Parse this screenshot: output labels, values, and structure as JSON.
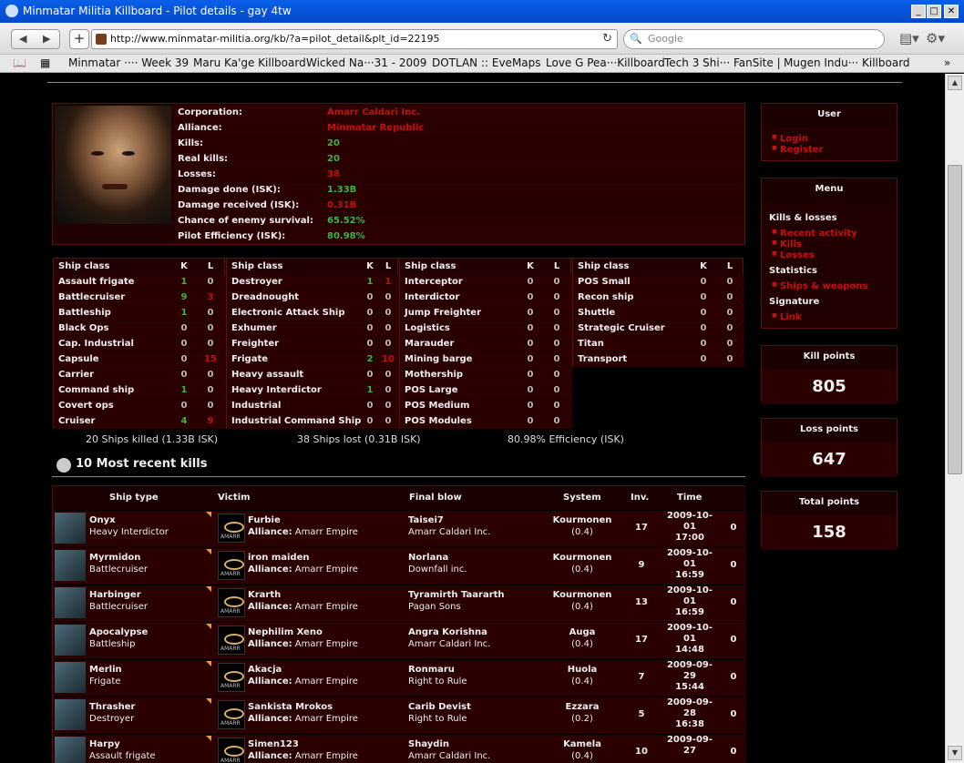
{
  "window": {
    "title": "Minmatar Militia Killboard - Pilot details - gay 4tw"
  },
  "toolbar": {
    "url": "http://www.minmatar-militia.org/kb/?a=pilot_detail&plt_id=22195",
    "search_placeholder": "Google"
  },
  "bookmarks": [
    "Minmatar ···· Week 39",
    "Maru Ka'ge Killboard",
    "Wicked Na···31 - 2009",
    "DOTLAN :: EveMaps",
    "Love G Pea···Killboard",
    "Tech 3 Shi··· FanSite |",
    "Mugen Indu··· Killboard"
  ],
  "pilot": {
    "rows": [
      {
        "label": "Corporation:",
        "value": "Amarr Caldari Inc.",
        "tone": "red"
      },
      {
        "label": "Alliance:",
        "value": "Minmatar Republic",
        "tone": "red"
      },
      {
        "label": "Kills:",
        "value": "20",
        "tone": "green"
      },
      {
        "label": "Real kills:",
        "value": "20",
        "tone": "green"
      },
      {
        "label": "Losses:",
        "value": "38",
        "tone": "red"
      },
      {
        "label": "Damage done (ISK):",
        "value": "1.33B",
        "tone": "green"
      },
      {
        "label": "Damage received (ISK):",
        "value": "0.31B",
        "tone": "red"
      },
      {
        "label": "Chance of enemy survival:",
        "value": "65.52%",
        "tone": "green"
      },
      {
        "label": "Pilot Efficiency (ISK):",
        "value": "80.98%",
        "tone": "green"
      }
    ]
  },
  "ship_classes": {
    "header": {
      "name": "Ship class",
      "k": "K",
      "l": "L"
    },
    "tables": [
      [
        [
          "Assault frigate",
          "1",
          "0"
        ],
        [
          "Battlecruiser",
          "9",
          "3"
        ],
        [
          "Battleship",
          "1",
          "0"
        ],
        [
          "Black Ops",
          "0",
          "0"
        ],
        [
          "Cap. Industrial",
          "0",
          "0"
        ],
        [
          "Capsule",
          "0",
          "15"
        ],
        [
          "Carrier",
          "0",
          "0"
        ],
        [
          "Command ship",
          "1",
          "0"
        ],
        [
          "Covert ops",
          "0",
          "0"
        ],
        [
          "Cruiser",
          "4",
          "9"
        ]
      ],
      [
        [
          "Destroyer",
          "1",
          "1"
        ],
        [
          "Dreadnought",
          "0",
          "0"
        ],
        [
          "Electronic Attack Ship",
          "0",
          "0"
        ],
        [
          "Exhumer",
          "0",
          "0"
        ],
        [
          "Freighter",
          "0",
          "0"
        ],
        [
          "Frigate",
          "2",
          "10"
        ],
        [
          "Heavy assault",
          "0",
          "0"
        ],
        [
          "Heavy Interdictor",
          "1",
          "0"
        ],
        [
          "Industrial",
          "0",
          "0"
        ],
        [
          "Industrial Command Ship",
          "0",
          "0"
        ]
      ],
      [
        [
          "Interceptor",
          "0",
          "0"
        ],
        [
          "Interdictor",
          "0",
          "0"
        ],
        [
          "Jump Freighter",
          "0",
          "0"
        ],
        [
          "Logistics",
          "0",
          "0"
        ],
        [
          "Marauder",
          "0",
          "0"
        ],
        [
          "Mining barge",
          "0",
          "0"
        ],
        [
          "Mothership",
          "0",
          "0"
        ],
        [
          "POS Large",
          "0",
          "0"
        ],
        [
          "POS Medium",
          "0",
          "0"
        ],
        [
          "POS Modules",
          "0",
          "0"
        ]
      ],
      [
        [
          "POS Small",
          "0",
          "0"
        ],
        [
          "Recon ship",
          "0",
          "0"
        ],
        [
          "Shuttle",
          "0",
          "0"
        ],
        [
          "Strategic Cruiser",
          "0",
          "0"
        ],
        [
          "Titan",
          "0",
          "0"
        ],
        [
          "Transport",
          "0",
          "0"
        ]
      ]
    ],
    "summary": {
      "killed": "20 Ships killed (1.33B ISK)",
      "lost": "38 Ships lost (0.31B ISK)",
      "efficiency": "80.98% Efficiency (ISK)"
    }
  },
  "recent": {
    "title": "10 Most recent kills",
    "headers": {
      "ship": "Ship type",
      "victim": "Victim",
      "final": "Final blow",
      "system": "System",
      "inv": "Inv.",
      "time": "Time"
    },
    "rows": [
      {
        "ship": "Onyx",
        "class": "Heavy Interdictor",
        "victim": "Furbie",
        "valliance": "Amarr Empire",
        "final": "Taisei7",
        "fcorp": "Amarr Caldari Inc.",
        "system": "Kourmonen",
        "sec": "(0.4)",
        "inv": "17",
        "t1": "2009-10-",
        "t2": "01",
        "t3": "17:00",
        "extra": "0"
      },
      {
        "ship": "Myrmidon",
        "class": "Battlecruiser",
        "victim": "iron maiden",
        "valliance": "Amarr Empire",
        "final": "Norlana",
        "fcorp": "Downfall inc.",
        "system": "Kourmonen",
        "sec": "(0.4)",
        "inv": "9",
        "t1": "2009-10-",
        "t2": "01",
        "t3": "16:59",
        "extra": "0"
      },
      {
        "ship": "Harbinger",
        "class": "Battlecruiser",
        "victim": "Krarth",
        "valliance": "Amarr Empire",
        "final": "Tyramirth Taararth",
        "fcorp": "Pagan Sons",
        "system": "Kourmonen",
        "sec": "(0.4)",
        "inv": "13",
        "t1": "2009-10-",
        "t2": "01",
        "t3": "16:59",
        "extra": "0"
      },
      {
        "ship": "Apocalypse",
        "class": "Battleship",
        "victim": "Nephilim Xeno",
        "valliance": "Amarr Empire",
        "final": "Angra Korishna",
        "fcorp": "Amarr Caldari Inc.",
        "system": "Auga",
        "sec": "(0.4)",
        "inv": "17",
        "t1": "2009-10-",
        "t2": "01",
        "t3": "14:48",
        "extra": "0"
      },
      {
        "ship": "Merlin",
        "class": "Frigate",
        "victim": "Akacja",
        "valliance": "Amarr Empire",
        "final": "Ronmaru",
        "fcorp": "Right to Rule",
        "system": "Huola",
        "sec": "(0.4)",
        "inv": "7",
        "t1": "2009-09-",
        "t2": "29",
        "t3": "15:44",
        "extra": "0"
      },
      {
        "ship": "Thrasher",
        "class": "Destroyer",
        "victim": "Sankista Mrokos",
        "valliance": "Amarr Empire",
        "final": "Carib Devist",
        "fcorp": "Right to Rule",
        "system": "Ezzara",
        "sec": "(0.2)",
        "inv": "5",
        "t1": "2009-09-",
        "t2": "28",
        "t3": "16:38",
        "extra": "0"
      },
      {
        "ship": "Harpy",
        "class": "Assault frigate",
        "victim": "Simen123",
        "valliance": "Amarr Empire",
        "final": "Shaydin",
        "fcorp": "Amarr Caldari Inc.",
        "system": "Kamela",
        "sec": "(0.4)",
        "inv": "10",
        "t1": "2009-09-",
        "t2": "27",
        "t3": "",
        "extra": "0"
      }
    ],
    "alliance_label": "Alliance:"
  },
  "sidebar": {
    "user": {
      "title": "User",
      "items": [
        "Login",
        "Register"
      ]
    },
    "menu": {
      "title": "Menu",
      "sections": [
        {
          "title": "Kills & losses",
          "items": [
            "Recent activity",
            "Kills",
            "Losses"
          ]
        },
        {
          "title": "Statistics",
          "items": [
            "Ships & weapons"
          ]
        },
        {
          "title": "Signature",
          "items": [
            "Link"
          ]
        }
      ]
    },
    "kill_points": {
      "title": "Kill points",
      "value": "805"
    },
    "loss_points": {
      "title": "Loss points",
      "value": "647"
    },
    "total_points": {
      "title": "Total points",
      "value": "158"
    }
  }
}
